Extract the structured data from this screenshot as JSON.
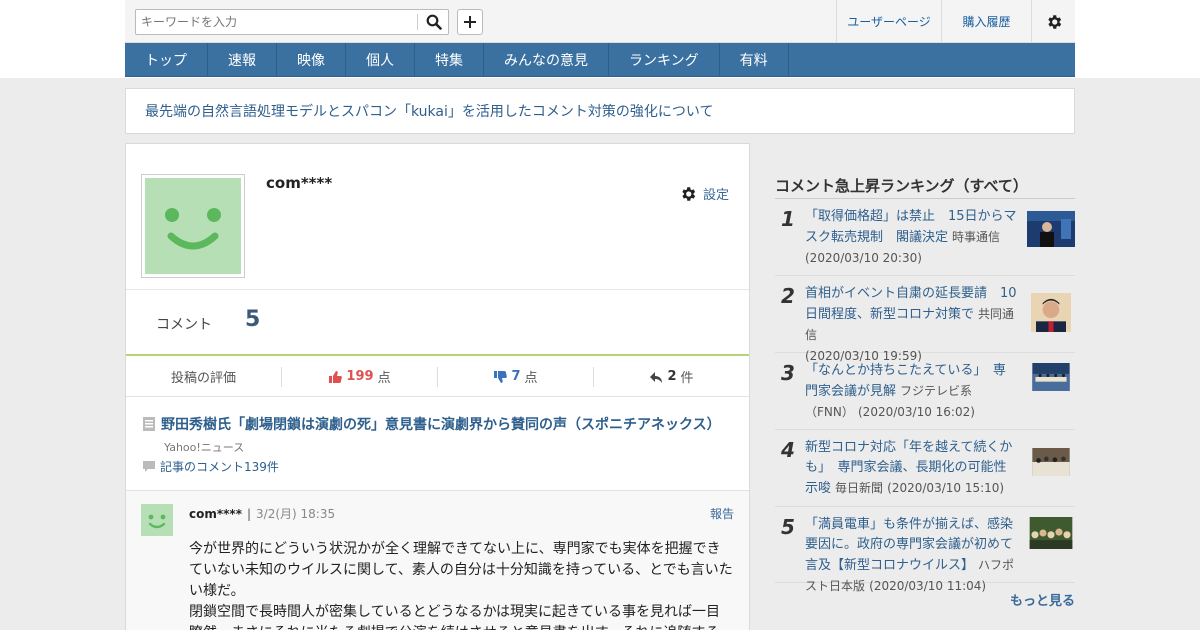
{
  "header": {
    "search_placeholder": "キーワードを入力",
    "links": [
      "ユーザーページ",
      "購入履歴"
    ]
  },
  "nav": [
    "トップ",
    "速報",
    "映像",
    "個人",
    "特集",
    "みんなの意見",
    "ランキング",
    "有料"
  ],
  "notice": "最先端の自然言語処理モデルとスパコン「kukai」を活用したコメント対策の強化について",
  "profile": {
    "username": "com****",
    "settings_label": "設定",
    "comment_label": "コメント",
    "comment_count": "5"
  },
  "stats": {
    "label": "投稿の評価",
    "likes": "199",
    "likes_unit": "点",
    "dislikes": "7",
    "dislikes_unit": "点",
    "replies": "2",
    "replies_unit": "件"
  },
  "article": {
    "title": "野田秀樹氏「劇場閉鎖は演劇の死」意見書に演劇界から賛同の声（スポニチアネックス）",
    "source": "Yahoo!ニュース",
    "comments_link": "記事のコメント139件"
  },
  "comment": {
    "user": "com****",
    "separator": "|",
    "date": "3/2(月) 18:35",
    "report": "報告",
    "text": "今が世界的にどういう状況かが全く理解できてない上に、専門家でも実体を把握できていない未知のウイルスに関して、素人の自分は十分知識を持っている、とでも言いたい様だ。\n閉鎖空間で長時間人が密集しているとどうなるかは現実に起きている事を見れば一目瞭然。まさにそれに当たる劇場で公演を続けさせろと意見書を出す。それに追随する"
  },
  "ranking": {
    "title": "コメント急上昇ランキング（すべて）",
    "items": [
      {
        "no": "1",
        "headline": "「取得価格超」は禁止　15日からマスク転売規制　閣議決定",
        "source": "時事通信",
        "date": "(2020/03/10 20:30)"
      },
      {
        "no": "2",
        "headline": "首相がイベント自粛の延長要請　10日間程度、新型コロナ対策で",
        "source": "共同通信",
        "date": "(2020/03/10 19:59)"
      },
      {
        "no": "3",
        "headline": "「なんとか持ちこたえている」　専門家会議が見解",
        "source": "フジテレビ系（FNN）",
        "date": "(2020/03/10 16:02)"
      },
      {
        "no": "4",
        "headline": "新型コロナ対応「年を越えて続くかも」　専門家会議、長期化の可能性示唆",
        "source": "毎日新聞",
        "date": "(2020/03/10 15:10)"
      },
      {
        "no": "5",
        "headline": "「満員電車」も条件が揃えば、感染要因に。政府の専門家会議が初めて言及【新型コロナウイルス】",
        "source": "ハフポスト日本版",
        "date": "(2020/03/10 11:04)"
      }
    ],
    "more": "もっと見る"
  },
  "colors": {
    "nav": "#3b71a1",
    "link": "#2e5f8d",
    "avatar": "#b7dfb6",
    "like": "#e05050",
    "dislike": "#3a72c0",
    "divider": "#b7d370"
  },
  "icons": [
    "search-icon",
    "plus-icon",
    "gear-icon",
    "thumbs-up-icon",
    "thumbs-down-icon",
    "reply-icon",
    "document-icon",
    "speech-bubble-icon",
    "smiley-avatar-icon"
  ]
}
